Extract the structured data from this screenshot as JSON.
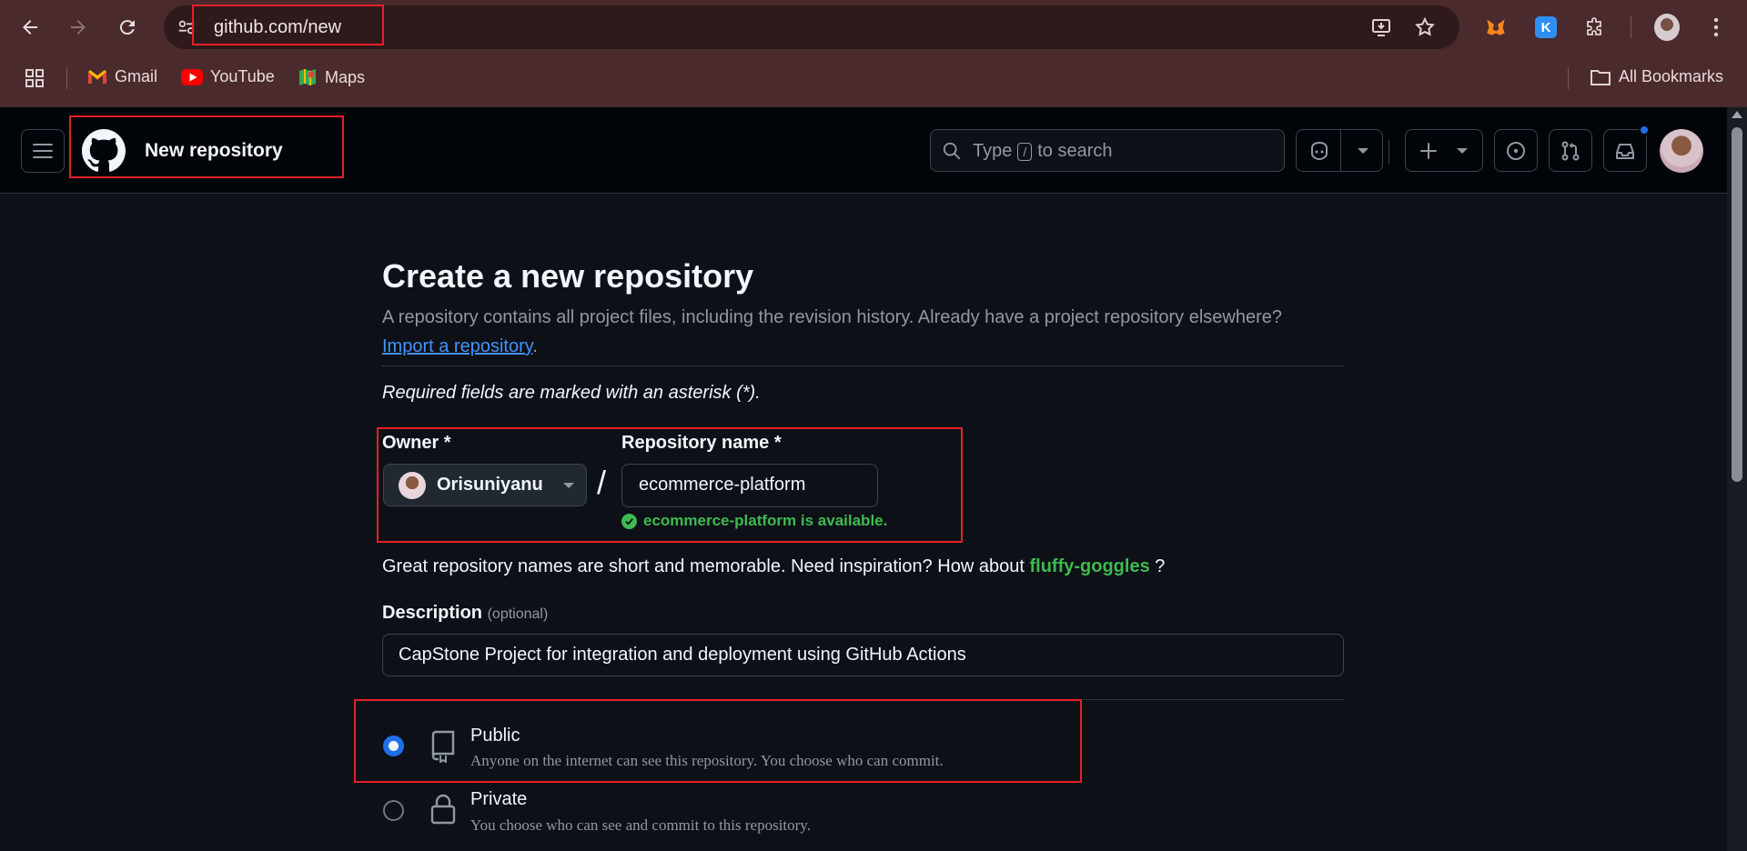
{
  "browser": {
    "url": "github.com/new",
    "bookmarks": [
      {
        "label": "Gmail",
        "icon": "gmail-icon"
      },
      {
        "label": "YouTube",
        "icon": "youtube-icon"
      },
      {
        "label": "Maps",
        "icon": "maps-icon"
      }
    ],
    "all_bookmarks": "All Bookmarks"
  },
  "header": {
    "title": "New repository",
    "search_prefix": "Type",
    "search_key": "/",
    "search_suffix": "to search"
  },
  "form": {
    "heading": "Create a new repository",
    "subtitle": "A repository contains all project files, including the revision history. Already have a project repository elsewhere?",
    "import_link": "Import a repository",
    "import_suffix": ".",
    "required_note": "Required fields are marked with an asterisk (*).",
    "owner_label": "Owner *",
    "owner_value": "Orisuniyanu",
    "slash": "/",
    "repo_label": "Repository name *",
    "repo_value": "ecommerce-platform",
    "availability": "ecommerce-platform is available.",
    "suggest_prefix": "Great repository names are short and memorable. Need inspiration? How about",
    "suggest_name": "fluffy-goggles",
    "suggest_suffix": "?",
    "description_label": "Description",
    "description_optional": "(optional)",
    "description_value": "CapStone Project for integration and deployment using GitHub Actions",
    "visibility": [
      {
        "title": "Public",
        "desc": "Anyone on the internet can see this repository. You choose who can commit.",
        "checked": true
      },
      {
        "title": "Private",
        "desc": "You choose who can see and commit to this repository.",
        "checked": false
      }
    ]
  },
  "colors": {
    "accent": "#1f6feb",
    "success": "#3fb950",
    "highlight_box": "#e5202a",
    "link": "#4493f8"
  }
}
